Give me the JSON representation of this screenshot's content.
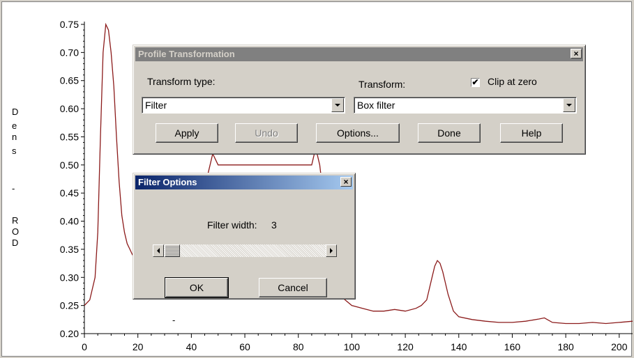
{
  "plot": {
    "ylabel_letters": [
      "D",
      "e",
      "n",
      "s",
      "-",
      "R",
      "O",
      "D"
    ]
  },
  "chart_data": {
    "type": "line",
    "xlim": [
      0,
      205
    ],
    "ylim": [
      0.2,
      0.75
    ],
    "xticks": [
      0,
      20,
      40,
      60,
      80,
      100,
      120,
      140,
      160,
      180,
      200
    ],
    "yticks": [
      "0.20",
      "0.25",
      "0.30",
      "0.35",
      "0.40",
      "0.45",
      "0.50",
      "0.55",
      "0.60",
      "0.65",
      "0.70",
      "0.75"
    ],
    "ylabel": "Dens - ROD",
    "line_color": "#8b1a1a",
    "series": [
      {
        "x": [
          0,
          2,
          4,
          5,
          6,
          7,
          8,
          9,
          10,
          11,
          12,
          13,
          14,
          15,
          16,
          17,
          18,
          20,
          25,
          30,
          35,
          40,
          45,
          47,
          48,
          50,
          55,
          60,
          65,
          70,
          75,
          80,
          85,
          86,
          87,
          88,
          89,
          90,
          92,
          95,
          100,
          104,
          108,
          112,
          116,
          120,
          124,
          126,
          128,
          130,
          131,
          132,
          133,
          134,
          136,
          138,
          140,
          145,
          150,
          155,
          160,
          165,
          170,
          172,
          175,
          180,
          185,
          190,
          195,
          200,
          205
        ],
        "y": [
          0.25,
          0.26,
          0.3,
          0.38,
          0.55,
          0.7,
          0.75,
          0.74,
          0.7,
          0.64,
          0.55,
          0.47,
          0.41,
          0.38,
          0.36,
          0.35,
          0.34,
          0.34,
          0.35,
          0.37,
          0.39,
          0.42,
          0.46,
          0.5,
          0.52,
          0.5,
          0.5,
          0.5,
          0.5,
          0.5,
          0.5,
          0.5,
          0.5,
          0.52,
          0.52,
          0.5,
          0.46,
          0.4,
          0.32,
          0.27,
          0.25,
          0.245,
          0.24,
          0.24,
          0.243,
          0.24,
          0.245,
          0.25,
          0.26,
          0.3,
          0.32,
          0.33,
          0.325,
          0.31,
          0.27,
          0.24,
          0.23,
          0.225,
          0.222,
          0.22,
          0.22,
          0.222,
          0.226,
          0.228,
          0.22,
          0.218,
          0.218,
          0.22,
          0.218,
          0.22,
          0.222
        ]
      }
    ]
  },
  "profile_dialog": {
    "title": "Profile Transformation",
    "close": "×",
    "transform_type_label": "Transform type:",
    "transform_type_value": "Filter",
    "transform_label": "Transform:",
    "transform_value": "Box filter",
    "clip_label": "Clip at zero",
    "clip_checked": "✔",
    "apply": "Apply",
    "undo": "Undo",
    "options": "Options...",
    "done": "Done",
    "help": "Help"
  },
  "filter_dialog": {
    "title": "Filter Options",
    "close": "×",
    "width_label": "Filter width:",
    "width_value": "3",
    "ok": "OK",
    "cancel": "Cancel"
  },
  "stray_mark": "-"
}
